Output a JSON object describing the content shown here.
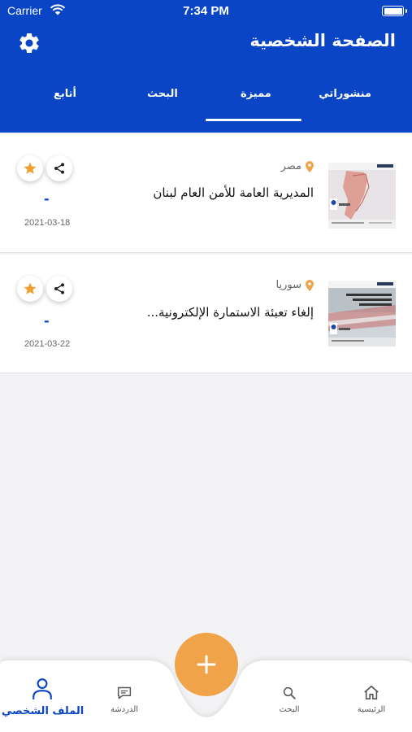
{
  "status_bar": {
    "carrier": "Carrier",
    "time": "7:34 PM"
  },
  "header": {
    "title": "الصفحة الشخصية"
  },
  "tabs": [
    {
      "label": "منشوراتي"
    },
    {
      "label": "مميزة"
    },
    {
      "label": "البحث"
    },
    {
      "label": "أتابع"
    }
  ],
  "active_tab": "مميزة",
  "posts": [
    {
      "location": "مصر",
      "title": "المديرية العامة للأمن العام لبنان",
      "dash": "-",
      "date": "2021-03-18"
    },
    {
      "location": "سوريا",
      "title": "إلغاء تعبئة الاستمارة الإلكترونية...",
      "dash": "-",
      "date": "2021-03-22"
    }
  ],
  "bottom_nav": {
    "home": "الرئيسية",
    "search": "البحث",
    "chat": "الدردشة",
    "profile": "الملف الشخصي"
  },
  "colors": {
    "primary": "#0a45c6",
    "accent": "#f0a348",
    "background": "#f3f3f5"
  },
  "icons": [
    "gear-icon",
    "location-pin-icon",
    "star-icon",
    "share-icon",
    "plus-icon",
    "home-icon",
    "search-icon",
    "chat-icon",
    "user-icon"
  ]
}
